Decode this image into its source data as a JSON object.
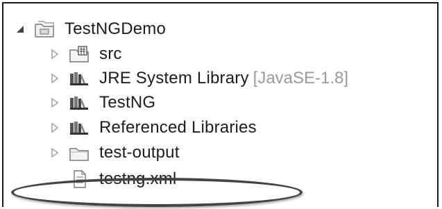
{
  "tree": {
    "project": {
      "label": "TestNGDemo",
      "icon": "project-folder-icon",
      "expanded": true
    },
    "children": [
      {
        "label": "src",
        "icon": "source-folder-icon"
      },
      {
        "label": "JRE System Library",
        "qualifier": "[JavaSE-1.8]",
        "icon": "library-icon"
      },
      {
        "label": "TestNG",
        "icon": "library-icon"
      },
      {
        "label": "Referenced Libraries",
        "icon": "library-icon"
      },
      {
        "label": "test-output",
        "icon": "folder-icon"
      },
      {
        "label": "testng.xml",
        "icon": "xml-file-icon",
        "highlighted": true
      }
    ]
  },
  "colors": {
    "highlight_ring": "#444444",
    "qualifier": "#9a9a9a"
  }
}
